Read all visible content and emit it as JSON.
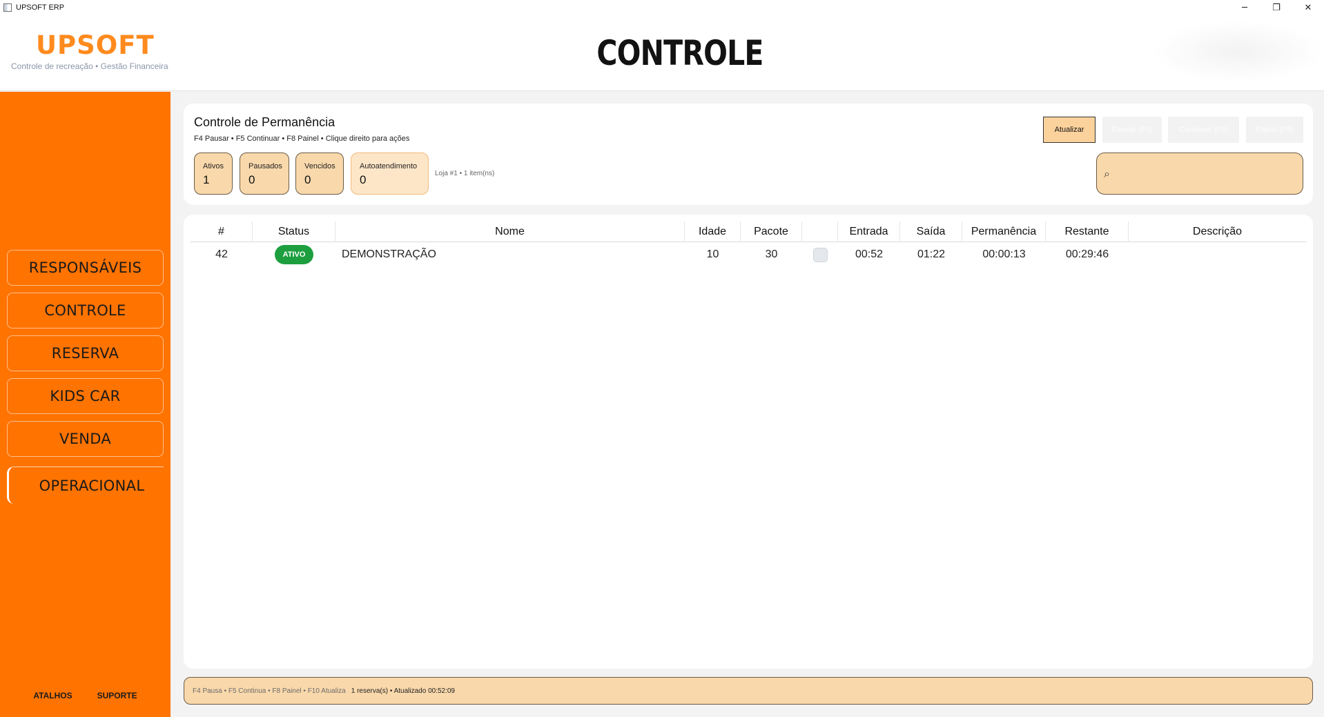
{
  "window": {
    "title": "UPSOFT ERP",
    "minimize": "─",
    "restore": "❐",
    "close": "✕"
  },
  "header": {
    "logo": "UPSOFT",
    "tagline": "Controle de recreação • Gestão Financeira",
    "page_title": "CONTROLE"
  },
  "sidebar": {
    "items": [
      {
        "label": "RESPONSÁVEIS"
      },
      {
        "label": "CONTROLE"
      },
      {
        "label": "RESERVA"
      },
      {
        "label": "KIDS CAR"
      },
      {
        "label": "VENDA"
      },
      {
        "label": "OPERACIONAL"
      }
    ],
    "links": {
      "shortcuts": "ATALHOS",
      "support": "SUPORTE"
    }
  },
  "panel": {
    "title": "Controle de Permanência",
    "subtitle": "F4 Pausar • F5 Continuar • F8 Painel • Clique direito para ações",
    "stats": [
      {
        "label": "Ativos",
        "value": "1"
      },
      {
        "label": "Pausados",
        "value": "0"
      },
      {
        "label": "Vencidos",
        "value": "0"
      },
      {
        "label": "Autoatendimento",
        "value": "0"
      }
    ],
    "store_info": "Loja #1 • 1 item(ns)",
    "buttons": {
      "refresh": "Atualizar",
      "pause": "Pausar (F4)",
      "continue": "Continuar (F5)",
      "panel": "Painel (F8)"
    },
    "search": {
      "icon": "search-icon",
      "value": ""
    }
  },
  "table": {
    "columns": [
      "#",
      "Status",
      "Nome",
      "Idade",
      "Pacote",
      "",
      "Entrada",
      "Saída",
      "Permanência",
      "Restante",
      "Descrição"
    ],
    "rows": [
      {
        "id": "42",
        "status": "ATIVO",
        "name": "DEMONSTRAÇÃO",
        "age": "10",
        "package": "30",
        "checked": false,
        "entry": "00:52",
        "exit": "01:22",
        "stay": "00:00:13",
        "remaining": "00:29:46",
        "description": ""
      }
    ]
  },
  "statusbar": {
    "keys": "F4 Pausa • F5 Continua • F8 Painel • F10 Atualiza",
    "info": "1 reserva(s) • Atualizado 00:52:09"
  },
  "colors": {
    "sidebar": "#ff7300",
    "logo": "#ff8a1e",
    "accent_fill": "#f9d8ab",
    "status_active": "#1d9f3f"
  }
}
